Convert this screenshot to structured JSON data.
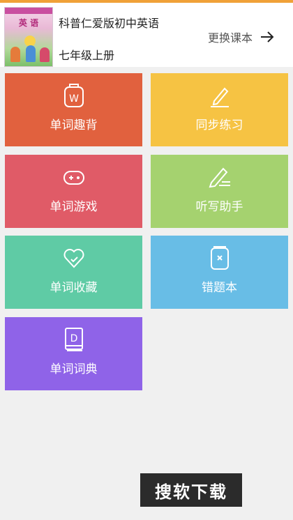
{
  "header": {
    "book_title": "科普仁爱版初中英语",
    "book_grade": "七年级上册",
    "change_label": "更换课本",
    "cover_word": "英 语"
  },
  "tiles": [
    {
      "label": "单词趣背",
      "icon": "w-badge-icon",
      "color": "#e1613e"
    },
    {
      "label": "同步练习",
      "icon": "pencil-icon",
      "color": "#f6c343"
    },
    {
      "label": "单词游戏",
      "icon": "gamepad-icon",
      "color": "#e05b67"
    },
    {
      "label": "听写助手",
      "icon": "write-icon",
      "color": "#a5d26f"
    },
    {
      "label": "单词收藏",
      "icon": "heart-icon",
      "color": "#5fcba5"
    },
    {
      "label": "错题本",
      "icon": "notebook-icon",
      "color": "#68bde6"
    },
    {
      "label": "单词词典",
      "icon": "dictionary-icon",
      "color": "#8f63e8"
    }
  ],
  "watermark": "搜软下载",
  "colors": {
    "accent": "#f0a138",
    "background": "#f0f0f0"
  }
}
